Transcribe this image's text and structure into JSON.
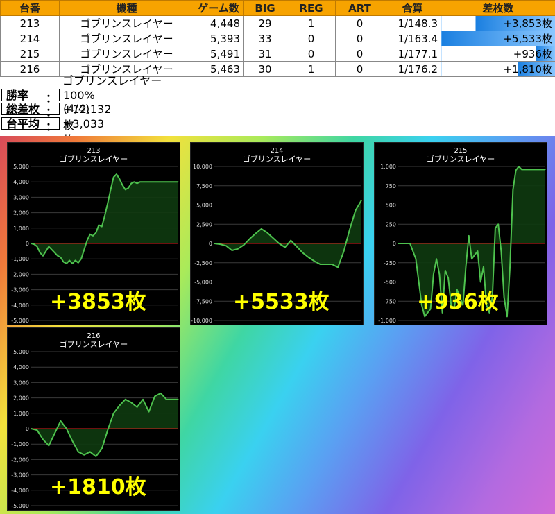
{
  "table": {
    "headers": [
      "台番",
      "機種",
      "ゲーム数",
      "BIG",
      "REG",
      "ART",
      "合算",
      "差枚数"
    ],
    "rows": [
      {
        "no": "213",
        "model": "ゴブリンスレイヤー",
        "games": "4,448",
        "big": "29",
        "reg": "1",
        "art": "0",
        "ratio": "1/148.3",
        "diff": "+3,853枚",
        "bar": 0.7
      },
      {
        "no": "214",
        "model": "ゴブリンスレイヤー",
        "games": "5,393",
        "big": "33",
        "reg": "0",
        "art": "0",
        "ratio": "1/163.4",
        "diff": "+5,533枚",
        "bar": 1.0
      },
      {
        "no": "215",
        "model": "ゴブリンスレイヤー",
        "games": "5,491",
        "big": "31",
        "reg": "0",
        "art": "0",
        "ratio": "1/177.1",
        "diff": "+936枚",
        "bar": 0.17
      },
      {
        "no": "216",
        "model": "ゴブリンスレイヤー",
        "games": "5,463",
        "big": "30",
        "reg": "1",
        "art": "0",
        "ratio": "1/176.2",
        "diff": "+1,810枚",
        "bar": 0.33
      }
    ]
  },
  "summary": {
    "title": "ゴブリンスレイヤー",
    "rows": [
      {
        "label": "勝率",
        "value": "100%(4/4)"
      },
      {
        "label": "総差枚",
        "value": "+12,132枚"
      },
      {
        "label": "台平均",
        "value": "+3,033枚"
      }
    ]
  },
  "colors": {
    "header_bg": "#f7a300",
    "line": "#4ec24e",
    "fill": "#0e3a10",
    "zero_line": "#e02020",
    "overlay_text": "#ffff00",
    "diff_text": "#0000ee"
  },
  "chart_data": [
    {
      "type": "area",
      "title": "213",
      "subtitle": "ゴブリンスレイヤー",
      "ylim": [
        -5000,
        5000
      ],
      "yticks": [
        "5,000",
        "4,000",
        "3,000",
        "2,000",
        "1,000",
        "0",
        "-1,000",
        "-2,000",
        "-3,000",
        "-4,000",
        "-5,000"
      ],
      "overlay": "+3853枚",
      "series": [
        {
          "x": [
            0,
            2,
            4,
            6,
            8,
            10,
            12,
            14,
            16,
            18,
            20,
            22,
            24,
            26,
            28,
            30,
            32,
            34,
            36,
            38,
            40,
            42,
            44,
            46,
            48,
            50,
            52,
            54,
            56,
            58,
            60,
            62,
            64,
            66,
            68,
            70,
            72,
            74,
            76,
            78,
            80,
            82,
            84,
            86,
            88,
            90,
            92,
            94,
            96,
            98,
            100
          ],
          "values": [
            0,
            -50,
            -200,
            -600,
            -800,
            -500,
            -200,
            -400,
            -600,
            -800,
            -900,
            -1200,
            -1300,
            -1100,
            -1300,
            -1100,
            -1250,
            -1000,
            -400,
            200,
            600,
            500,
            700,
            1200,
            1100,
            1800,
            2600,
            3500,
            4300,
            4500,
            4200,
            3800,
            3500,
            3600,
            3900,
            4000,
            3900,
            4000,
            4000,
            4000,
            4000,
            4000,
            4000,
            4000,
            4000,
            4000,
            4000,
            4000,
            4000,
            4000,
            4000
          ]
        }
      ]
    },
    {
      "type": "area",
      "title": "214",
      "subtitle": "ゴブリンスレイヤー",
      "ylim": [
        -10000,
        10000
      ],
      "yticks": [
        "10,000",
        "7,500",
        "5,000",
        "2,500",
        "0",
        "-2,500",
        "-5,000",
        "-7,500",
        "-10,000"
      ],
      "overlay": "+5533枚",
      "series": [
        {
          "x": [
            0,
            4,
            8,
            12,
            16,
            20,
            24,
            28,
            32,
            36,
            40,
            44,
            48,
            52,
            56,
            60,
            64,
            68,
            72,
            76,
            80,
            84,
            88,
            92,
            96,
            100
          ],
          "values": [
            0,
            -100,
            -300,
            -900,
            -700,
            -200,
            600,
            1300,
            1900,
            1400,
            700,
            0,
            -500,
            400,
            -400,
            -1200,
            -1800,
            -2300,
            -2700,
            -2700,
            -2700,
            -3100,
            -1000,
            1800,
            4300,
            5600
          ]
        }
      ]
    },
    {
      "type": "area",
      "title": "215",
      "subtitle": "ゴブリンスレイヤー",
      "ylim": [
        -1000,
        1000
      ],
      "yticks": [
        "1,000",
        "750",
        "500",
        "250",
        "0",
        "-250",
        "-500",
        "-750",
        "-1,000"
      ],
      "overlay": "+936枚",
      "series": [
        {
          "x": [
            0,
            4,
            8,
            12,
            16,
            18,
            20,
            22,
            24,
            26,
            28,
            30,
            32,
            34,
            36,
            38,
            40,
            42,
            44,
            46,
            48,
            50,
            52,
            54,
            56,
            58,
            60,
            62,
            64,
            66,
            68,
            70,
            72,
            74,
            76,
            78,
            80,
            82,
            84,
            86,
            88,
            90,
            92,
            94,
            96,
            98,
            100
          ],
          "values": [
            0,
            0,
            0,
            -200,
            -800,
            -950,
            -900,
            -850,
            -400,
            -200,
            -400,
            -900,
            -350,
            -450,
            -800,
            -850,
            -600,
            -700,
            -800,
            -300,
            100,
            -200,
            -150,
            -100,
            -500,
            -300,
            -800,
            -900,
            -700,
            200,
            250,
            -100,
            -700,
            -950,
            -300,
            700,
            950,
            1000,
            960,
            960,
            960,
            960,
            960,
            960,
            960,
            960,
            960
          ]
        }
      ]
    },
    {
      "type": "area",
      "title": "216",
      "subtitle": "ゴブリンスレイヤー",
      "ylim": [
        -5000,
        5000
      ],
      "yticks": [
        "5,000",
        "4,000",
        "3,000",
        "2,000",
        "1,000",
        "0",
        "-1,000",
        "-2,000",
        "-3,000",
        "-4,000",
        "-5,000"
      ],
      "overlay": "+1810枚",
      "series": [
        {
          "x": [
            0,
            4,
            8,
            12,
            16,
            20,
            24,
            28,
            32,
            36,
            40,
            44,
            48,
            52,
            56,
            60,
            64,
            68,
            72,
            76,
            80,
            84,
            88,
            92,
            96,
            100
          ],
          "values": [
            0,
            -100,
            -700,
            -1100,
            -300,
            500,
            0,
            -800,
            -1500,
            -1700,
            -1500,
            -1800,
            -1300,
            -100,
            1000,
            1500,
            1900,
            1700,
            1400,
            1900,
            1100,
            2100,
            2300,
            1900,
            1900,
            1900
          ]
        }
      ]
    }
  ]
}
